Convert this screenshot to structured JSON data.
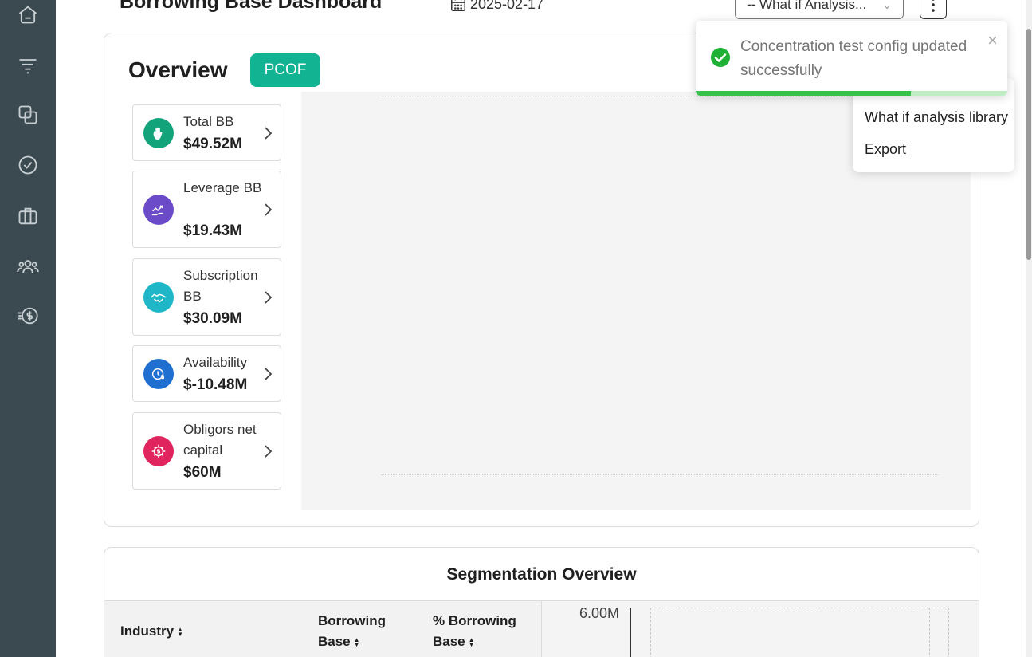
{
  "header": {
    "title": "Borrowing Base Dashboard",
    "date": "2025-02-17",
    "whatif_select": "-- What if Analysis...",
    "menu_icon": "kebab-menu-icon"
  },
  "sidebar": {
    "items": [
      {
        "icon": "home-icon"
      },
      {
        "icon": "funnel-icon"
      },
      {
        "icon": "copy-icon"
      },
      {
        "icon": "check-circle-icon"
      },
      {
        "icon": "briefcase-icon"
      },
      {
        "icon": "users-icon"
      },
      {
        "icon": "dollar-coin-icon"
      }
    ]
  },
  "overview": {
    "title": "Overview",
    "badge": "PCOF",
    "metrics": [
      {
        "label": "Total BB",
        "value": "$49.52M",
        "icon": "hand-icon",
        "color": "#12a37a"
      },
      {
        "label": "Leverage BB",
        "value": "$19.43M",
        "icon": "growth-hand-icon",
        "color": "#6b4bc8"
      },
      {
        "label": "Subscription BB",
        "value": "$30.09M",
        "icon": "handshake-icon",
        "color": "#1fb7c8"
      },
      {
        "label": "Availability",
        "value": "$-10.48M",
        "icon": "clock-dollar-icon",
        "color": "#1f6fd1"
      },
      {
        "label": "Obligors net capital",
        "value": "$60M",
        "icon": "gear-dollar-icon",
        "color": "#e0245e"
      }
    ]
  },
  "menu": {
    "items": [
      "What if analysis library",
      "Export"
    ]
  },
  "toast": {
    "message": "Concentration test config updated successfully",
    "close": "×",
    "progress": 0.69,
    "color": "#3ac14a"
  },
  "segmentation": {
    "title": "Segmentation Overview",
    "columns": [
      "Industry",
      "Borrowing Base",
      "% Borrowing Base"
    ],
    "chart_tick": "6.00M"
  },
  "colors": {
    "sidebar": "#3b4a51",
    "accent": "#12b393"
  }
}
